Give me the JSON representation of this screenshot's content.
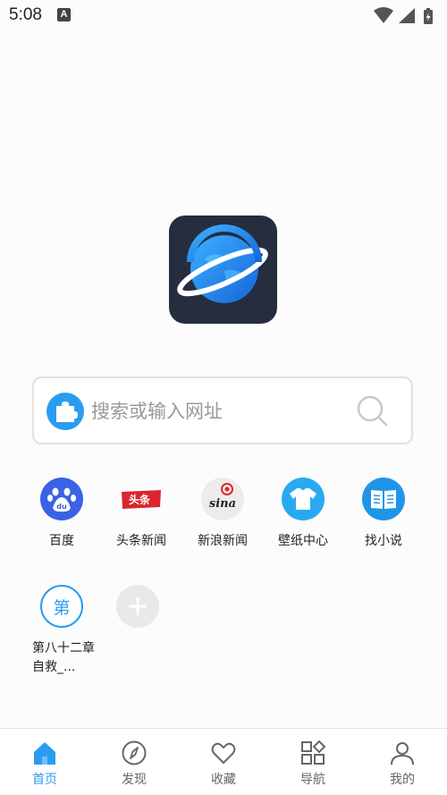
{
  "status_bar": {
    "time": "5:08",
    "notification_badge": "A"
  },
  "search": {
    "placeholder": "搜索或输入网址"
  },
  "shortcuts": [
    {
      "label": "百度",
      "icon": "baidu-paw-icon",
      "color": "#3a62e4"
    },
    {
      "label": "头条新闻",
      "icon": "toutiao-icon",
      "badge_text": "头条",
      "color": "#d8262e"
    },
    {
      "label": "新浪新闻",
      "icon": "sina-icon",
      "badge_text": "sina",
      "color": "#e0252b"
    },
    {
      "label": "壁纸中心",
      "icon": "tshirt-icon",
      "color": "#29aaf0"
    },
    {
      "label": "找小说",
      "icon": "book-icon",
      "color": "#1f95e8"
    },
    {
      "label": "第八十二章 自救_...",
      "icon": "bookmark-char-icon",
      "badge_text": "第",
      "color": "#2a9cf0"
    },
    {
      "label": "",
      "icon": "add-icon"
    }
  ],
  "bottom_nav": [
    {
      "label": "首页",
      "icon": "home-icon",
      "active": true
    },
    {
      "label": "发现",
      "icon": "compass-icon",
      "active": false
    },
    {
      "label": "收藏",
      "icon": "heart-icon",
      "active": false
    },
    {
      "label": "导航",
      "icon": "grid-icon",
      "active": false
    },
    {
      "label": "我的",
      "icon": "user-icon",
      "active": false
    }
  ],
  "colors": {
    "accent": "#2a9cf0",
    "logo_bg": "#262d3f"
  }
}
